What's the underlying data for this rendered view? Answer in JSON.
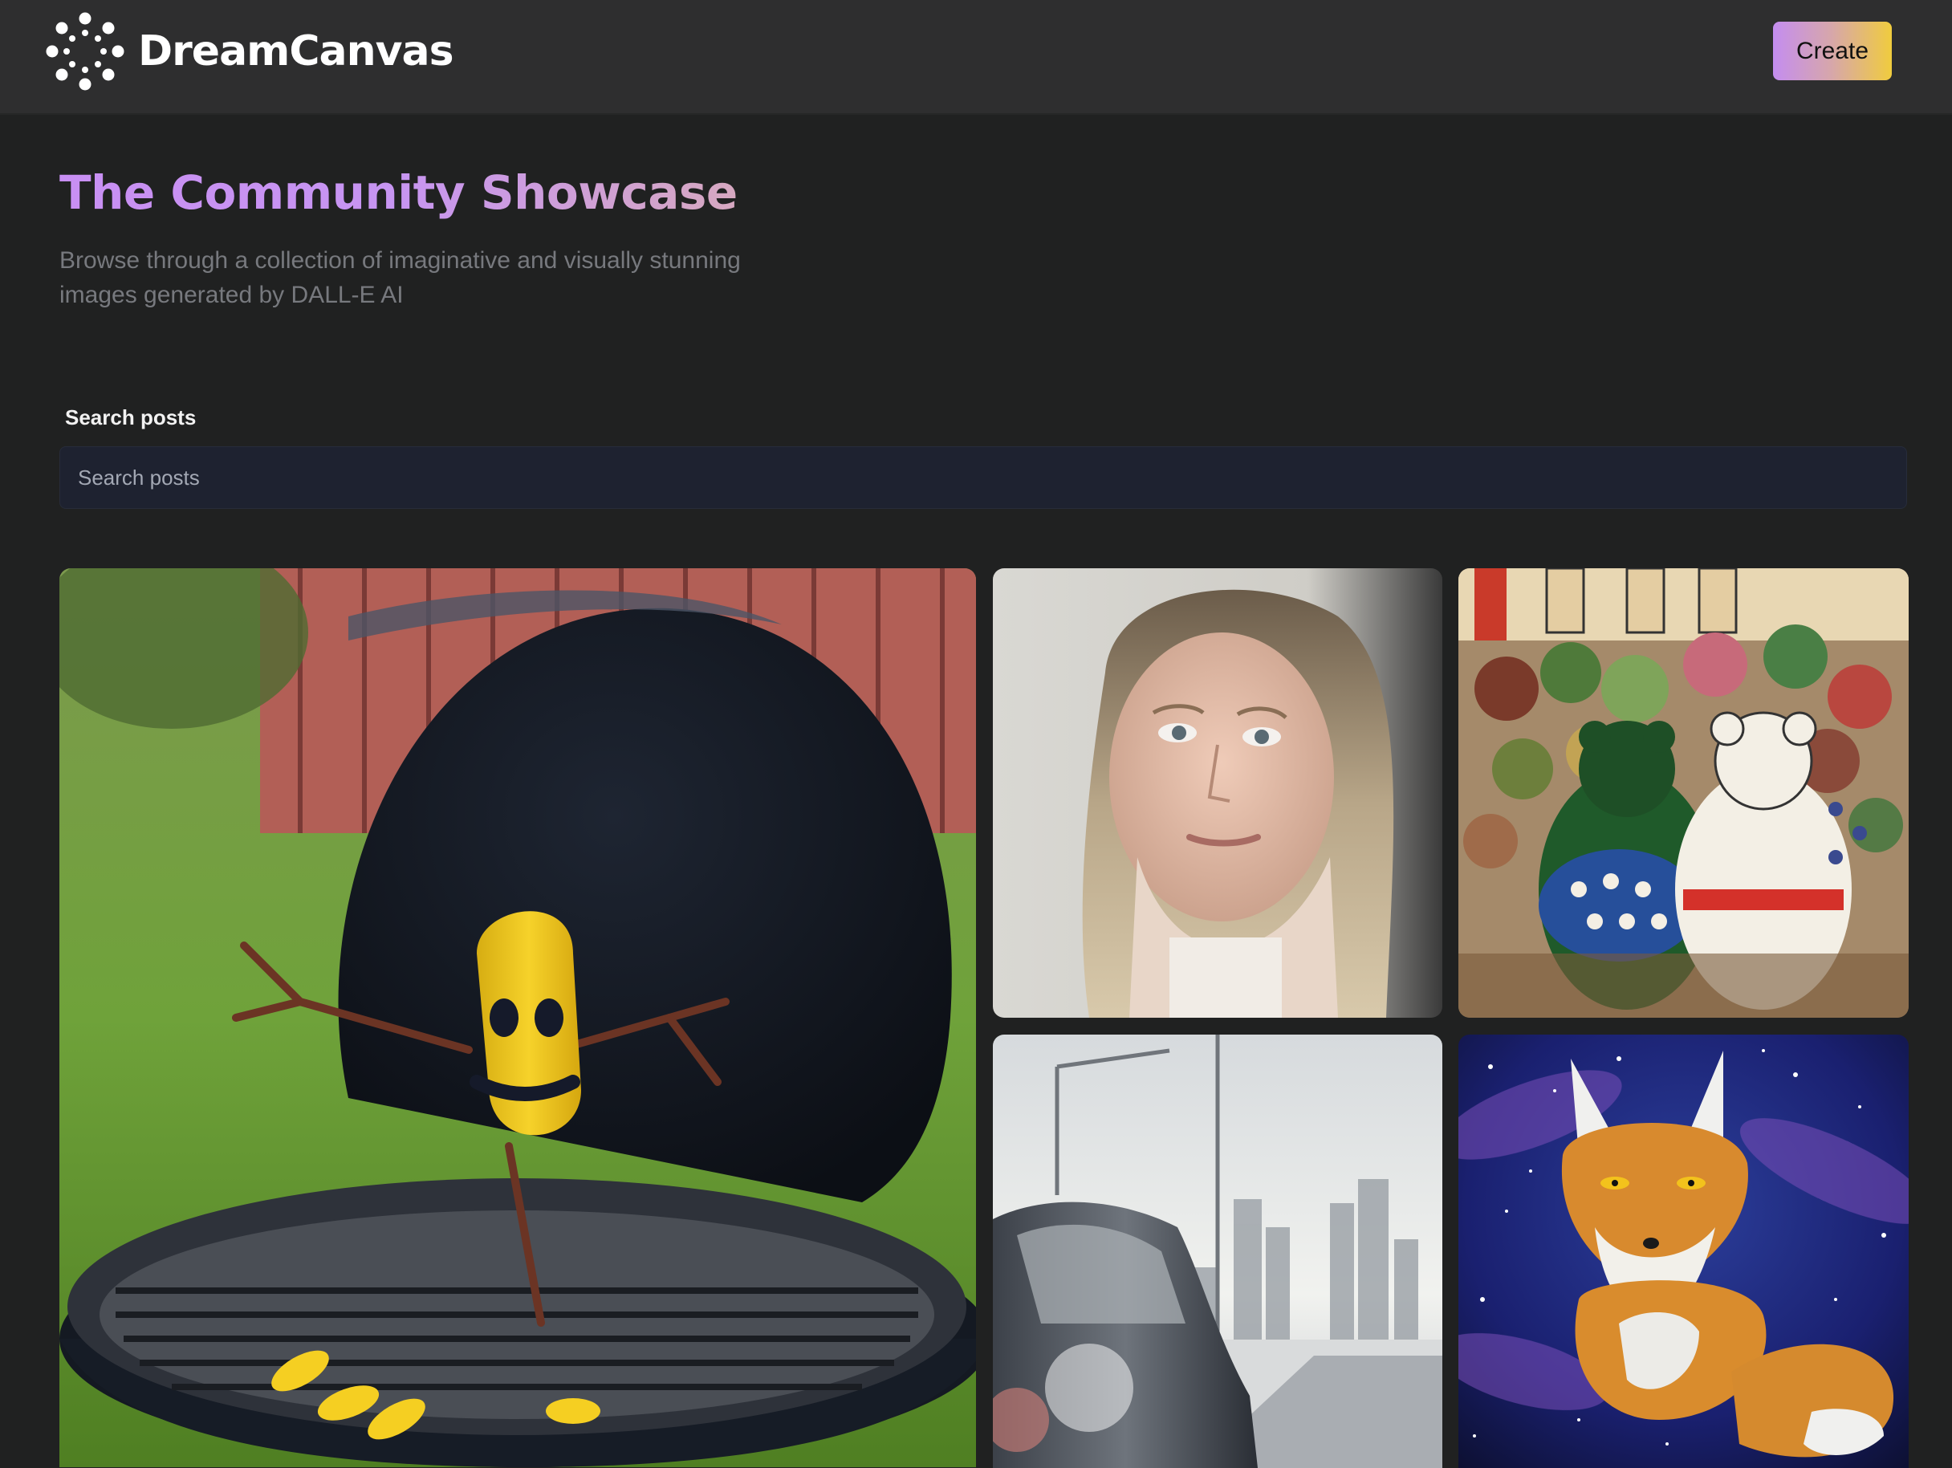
{
  "header": {
    "brand_name": "DreamCanvas",
    "logo_icon": "sun-dots-logo-icon",
    "create_label": "Create"
  },
  "hero": {
    "title": "The Community Showcase",
    "subtitle": "Browse through a collection of imaginative and visually stunning images generated by DALL-E AI"
  },
  "search": {
    "label": "Search posts",
    "placeholder": "Search posts",
    "value": ""
  },
  "gallery": {
    "items": [
      {
        "subject": "banana-on-grill-image"
      },
      {
        "subject": "woman-portrait-image"
      },
      {
        "subject": "teddy-bears-market-image"
      },
      {
        "subject": "car-city-sunrise-image"
      },
      {
        "subject": "fox-starry-night-image"
      }
    ]
  },
  "colors": {
    "page_bg": "#202121",
    "header_bg": "#2e2e2f",
    "title_gradient_start": "#c88ff3",
    "title_gradient_end": "#d6a8c0",
    "button_gradient_start": "#c48df0",
    "button_gradient_end": "#f0cc3e",
    "input_bg": "#1e2230",
    "subtitle": "#77797e"
  }
}
